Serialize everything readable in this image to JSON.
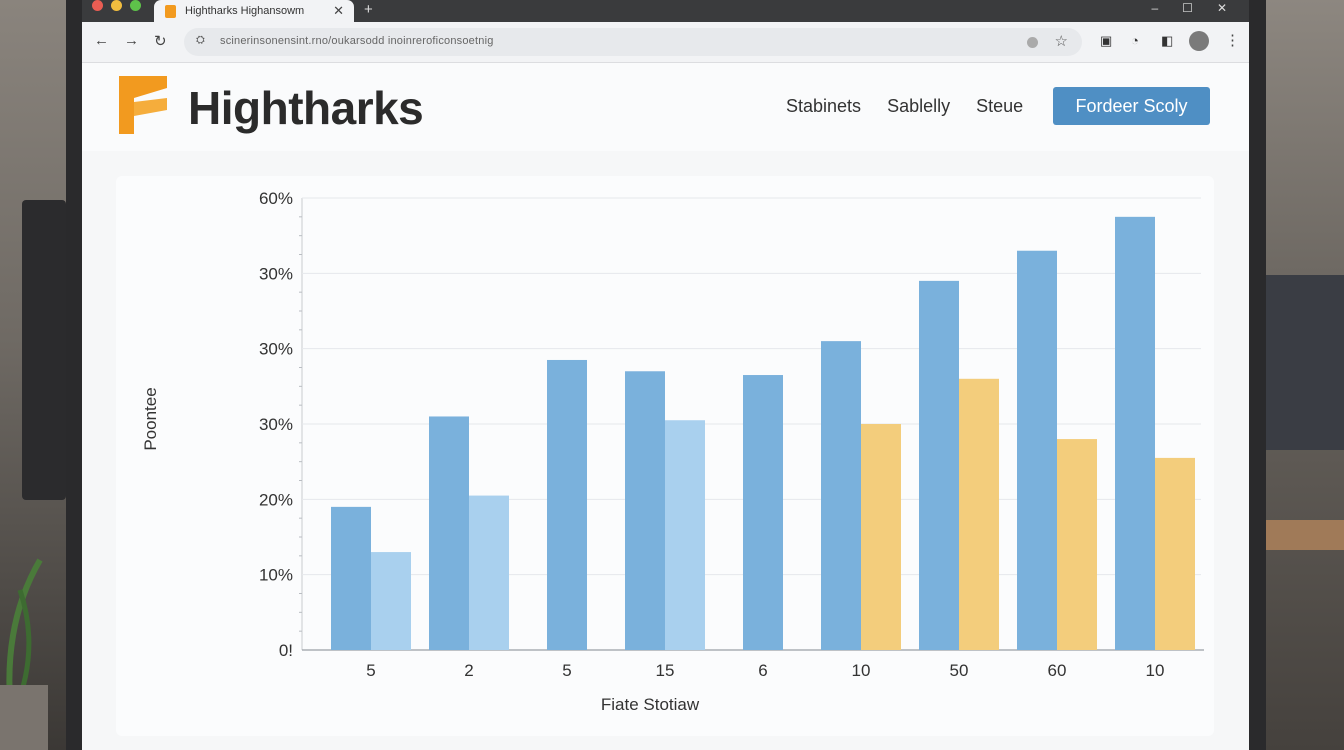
{
  "browser": {
    "tab_title": "Hightharks Highansowm",
    "url": "scinerinsonensint.rno/oukarsodd inoinreroficonsoetnig",
    "new_tab_symbol": "+",
    "tab_close_symbol": "✕"
  },
  "site": {
    "brand": "Hightharks",
    "nav": [
      "Stabinets",
      "Sablelly",
      "Steue"
    ],
    "cta_label": "Fordeer Scoly",
    "colors": {
      "brand_orange": "#f29a1f",
      "cta_blue": "#4f8fc4"
    }
  },
  "chart_data": {
    "type": "bar",
    "categories": [
      "5",
      "2",
      "5",
      "15",
      "6",
      "10",
      "50",
      "60",
      "10"
    ],
    "y_tick_labels": [
      "0!",
      "10%",
      "20%",
      "30%",
      "30%",
      "30%",
      "60%"
    ],
    "xlabel": "Fiate Stotiaw",
    "ylabel": "Poontee",
    "ylim": [
      0,
      60
    ],
    "series": [
      {
        "color": "#7ab1dc",
        "values": [
          19,
          31,
          38.5,
          37,
          36.5,
          41,
          49,
          53,
          57.5
        ]
      },
      {
        "color": "#a9d0ee",
        "values": [
          13,
          20.5,
          null,
          30.5,
          null,
          null,
          null,
          null,
          null
        ]
      },
      {
        "color": "#f3cd7c",
        "values": [
          null,
          null,
          null,
          null,
          null,
          30,
          36,
          28,
          25.5
        ]
      }
    ],
    "grid": true
  }
}
